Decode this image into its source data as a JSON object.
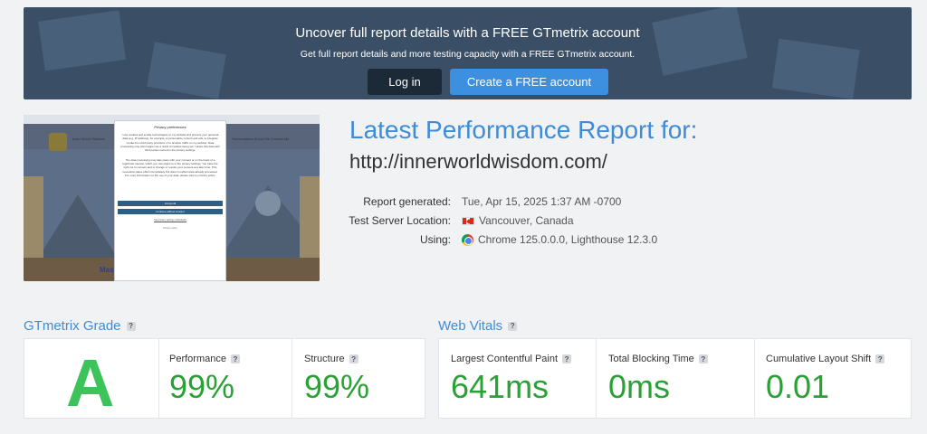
{
  "banner": {
    "title": "Uncover full report details with a FREE GTmetrix account",
    "subtitle": "Get full report details and more testing capacity with a FREE GTmetrix account.",
    "login_label": "Log in",
    "create_label": "Create a FREE account"
  },
  "thumbnail": {
    "site_name": "Inner World Wisdom",
    "nav_items": "Homemakers   About Me   Contact Me",
    "heading": "Mas                              ion,",
    "modal": {
      "title": "Privacy preferences",
      "text1": "I use cookies and similar technologies on my website and process your personal data (e.g. IP address), for example, to personalize content and ads, to integrate media from third-party providers or to analyze traffic on my website. Data processing may also happen as a result of cookies being set. I share this data with third parties named in the privacy settings.",
      "text2": "The data processing may take place with your consent or on the basis of a legitimate interest, which you can object to in the privacy settings. You have the right not to consent and to change or revoke your consent at a later time. This revocation takes effect immediately but does not affect data already processed. For more information on the use of your data, please visit my privacy policy.",
      "accept": "Accept all",
      "continue": "Continue without consent",
      "settings": "Set privacy settings individually",
      "footer": "Privacy policy"
    }
  },
  "report": {
    "title": "Latest Performance Report for:",
    "url": "http://innerworldwisdom.com/",
    "generated_label": "Report generated:",
    "generated_value": "Tue, Apr 15, 2025 1:37 AM -0700",
    "location_label": "Test Server Location:",
    "location_value": "Vancouver, Canada",
    "using_label": "Using:",
    "using_value": "Chrome 125.0.0.0, Lighthouse 12.3.0"
  },
  "grade_section": {
    "title": "GTmetrix Grade",
    "help": "?",
    "grade": "A",
    "grade_color": "#3cc45a",
    "performance_label": "Performance",
    "performance_value": "99%",
    "structure_label": "Structure",
    "structure_value": "99%"
  },
  "vitals_section": {
    "title": "Web Vitals",
    "help": "?",
    "lcp_label": "Largest Contentful Paint",
    "lcp_value": "641ms",
    "tbt_label": "Total Blocking Time",
    "tbt_value": "0ms",
    "cls_label": "Cumulative Layout Shift",
    "cls_value": "0.01"
  },
  "colors": {
    "accent": "#3e8cd8",
    "good": "#2aa134",
    "banner_bg": "#3a4f66"
  }
}
